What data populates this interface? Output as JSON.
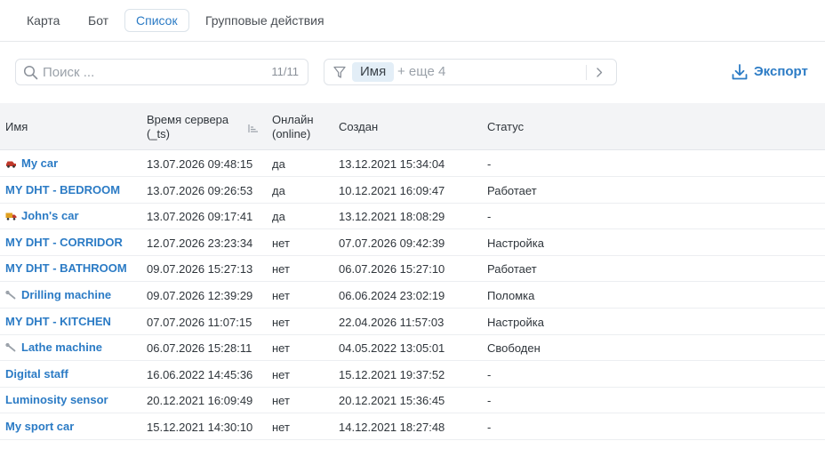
{
  "tabs": [
    {
      "label": "Карта",
      "active": false
    },
    {
      "label": "Бот",
      "active": false
    },
    {
      "label": "Список",
      "active": true
    },
    {
      "label": "Групповые действия",
      "active": false
    }
  ],
  "toolbar": {
    "search_placeholder": "Поиск ...",
    "search_count": "11/11",
    "filter_chip": "Имя",
    "filter_more": "+ еще 4",
    "export_label": "Экспорт"
  },
  "table": {
    "headers": {
      "name": "Имя",
      "server_time_line1": "Время сервера",
      "server_time_line2": "(_ts)",
      "online_line1": "Онлайн",
      "online_line2": "(online)",
      "created": "Создан",
      "status": "Статус"
    },
    "rows": [
      {
        "name": "My car",
        "icon": "car-icon",
        "time": "13.07.2026 09:48:15",
        "online": "да",
        "created": "13.12.2021 15:34:04",
        "status": "-"
      },
      {
        "name": "MY DHT - BEDROOM",
        "icon": "",
        "time": "13.07.2026 09:26:53",
        "online": "да",
        "created": "10.12.2021 16:09:47",
        "status": "Работает"
      },
      {
        "name": "John's car",
        "icon": "truck-icon",
        "time": "13.07.2026 09:17:41",
        "online": "да",
        "created": "13.12.2021 18:08:29",
        "status": "-"
      },
      {
        "name": "MY DHT - CORRIDOR",
        "icon": "",
        "time": "12.07.2026 23:23:34",
        "online": "нет",
        "created": "07.07.2026 09:42:39",
        "status": "Настройка"
      },
      {
        "name": "MY DHT - BATHROOM",
        "icon": "",
        "time": "09.07.2026 15:27:13",
        "online": "нет",
        "created": "06.07.2026 15:27:10",
        "status": "Работает"
      },
      {
        "name": "Drilling machine",
        "icon": "wrench-icon",
        "time": "09.07.2026 12:39:29",
        "online": "нет",
        "created": "06.06.2024 23:02:19",
        "status": "Поломка"
      },
      {
        "name": "MY DHT - KITCHEN",
        "icon": "",
        "time": "07.07.2026 11:07:15",
        "online": "нет",
        "created": "22.04.2026 11:57:03",
        "status": "Настройка"
      },
      {
        "name": "Lathe machine",
        "icon": "wrench-icon",
        "time": "06.07.2026 15:28:11",
        "online": "нет",
        "created": "04.05.2022 13:05:01",
        "status": "Свободен"
      },
      {
        "name": "Digital staff",
        "icon": "",
        "time": "16.06.2022 14:45:36",
        "online": "нет",
        "created": "15.12.2021 19:37:52",
        "status": "-"
      },
      {
        "name": "Luminosity sensor",
        "icon": "",
        "time": "20.12.2021 16:09:49",
        "online": "нет",
        "created": "20.12.2021 15:36:45",
        "status": "-"
      },
      {
        "name": "My sport car",
        "icon": "",
        "time": "15.12.2021 14:30:10",
        "online": "нет",
        "created": "14.12.2021 18:27:48",
        "status": "-"
      }
    ]
  },
  "colors": {
    "accent": "#2b7bc5",
    "header_bg": "#f3f4f6",
    "chip_bg": "#e3eef7"
  }
}
